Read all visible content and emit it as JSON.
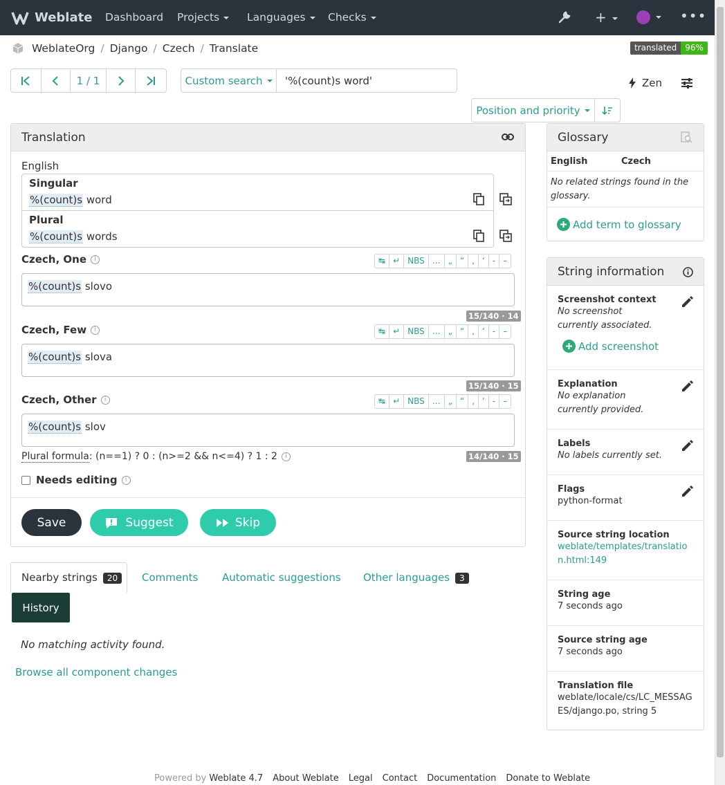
{
  "nav": {
    "brand": "Weblate",
    "items": [
      "Dashboard",
      "Projects",
      "Languages",
      "Checks"
    ]
  },
  "breadcrumb": [
    "WeblateOrg",
    "Django",
    "Czech",
    "Translate"
  ],
  "badge": {
    "label": "translated",
    "value": "96%"
  },
  "pager": {
    "position": "1 / 1"
  },
  "search": {
    "mode_label": "Custom search",
    "query": "'%(count)s word'"
  },
  "zen_label": "Zen",
  "sort_label": "Position and priority",
  "translation": {
    "title": "Translation",
    "source_lang": "English",
    "singular_label": "Singular",
    "singular_var": "%(count)s",
    "singular_rest": " word",
    "plural_label": "Plural",
    "plural_var": "%(count)s",
    "plural_rest": " words",
    "forms": [
      {
        "label": "Czech, One",
        "var": "%(count)s",
        "rest": " slovo",
        "counter": "15/140 · 14"
      },
      {
        "label": "Czech, Few",
        "var": "%(count)s",
        "rest": " slova",
        "counter": "15/140 · 15"
      },
      {
        "label": "Czech, Other",
        "var": "%(count)s",
        "rest": " slov",
        "counter": "14/140 · 15"
      }
    ],
    "special_chars": [
      "↹",
      "↵",
      "NBS",
      "…",
      "„",
      "“",
      ",",
      "‘",
      "-",
      "–"
    ],
    "plural_formula_label": "Plural formula",
    "plural_formula": ": (n==1) ? 0 : (n>=2 && n<=4) ? 1 : 2",
    "needs_editing": "Needs editing",
    "save": "Save",
    "suggest": "Suggest",
    "skip": "Skip"
  },
  "tabs": {
    "nearby": "Nearby strings",
    "nearby_count": "20",
    "comments": "Comments",
    "auto": "Automatic suggestions",
    "other": "Other languages",
    "other_count": "3",
    "history": "History"
  },
  "history": {
    "empty": "No matching activity found.",
    "browse": "Browse all component changes"
  },
  "glossary": {
    "title": "Glossary",
    "col_en": "English",
    "col_cs": "Czech",
    "empty": "No related strings found in the glossary.",
    "add": "Add term to glossary"
  },
  "string_info": {
    "title": "String information",
    "screenshot_title": "Screenshot context",
    "screenshot_text": "No screenshot currently associated.",
    "add_screenshot": "Add screenshot",
    "explanation_title": "Explanation",
    "explanation_text": "No explanation currently provided.",
    "labels_title": "Labels",
    "labels_text": "No labels currently set.",
    "flags_title": "Flags",
    "flags_text": "python-format",
    "location_title": "Source string location",
    "location_text": "weblate/templates/translation.html:149",
    "age_title": "String age",
    "age_text": "7 seconds ago",
    "src_age_title": "Source string age",
    "src_age_text": "7 seconds ago",
    "file_title": "Translation file",
    "file_text": "weblate/locale/cs/LC_MESSAGES/django.po, string 5"
  },
  "footer": {
    "powered": "Powered by",
    "version": "Weblate 4.7",
    "links": [
      "About Weblate",
      "Legal",
      "Contact",
      "Documentation",
      "Donate to Weblate"
    ]
  },
  "colors": {
    "navbar": "#2b333d",
    "accent": "#2a9d8f",
    "dark": "#2b333d",
    "badge_ok": "#3fb618",
    "badge_dark": "#555555"
  }
}
